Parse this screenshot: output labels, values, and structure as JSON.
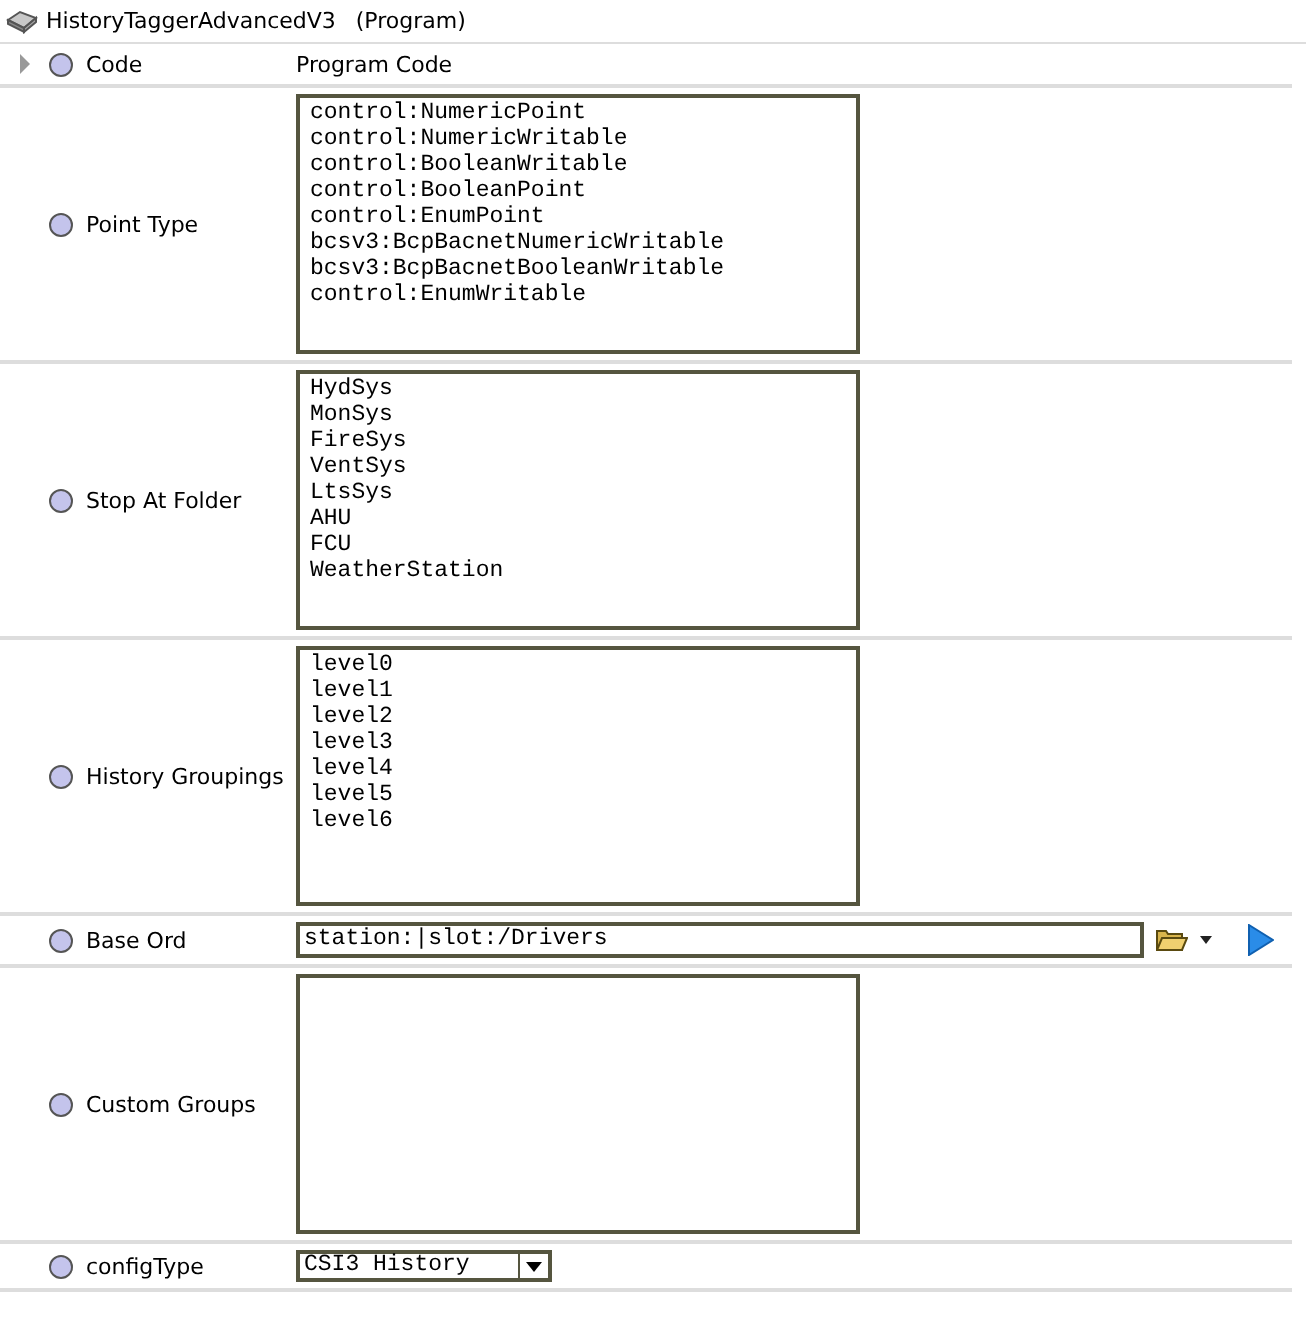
{
  "header": {
    "title": "HistoryTaggerAdvancedV3",
    "type": "(Program)"
  },
  "rows": [
    {
      "label": "Code",
      "kind": "text",
      "expanded": false,
      "value": "Program Code"
    },
    {
      "label": "Point Type",
      "kind": "textarea",
      "lines": [
        "control:NumericPoint",
        "control:NumericWritable",
        "control:BooleanWritable",
        "control:BooleanPoint",
        "control:EnumPoint",
        "bcsv3:BcpBacnetNumericWritable",
        "bcsv3:BcpBacnetBooleanWritable",
        "control:EnumWritable"
      ]
    },
    {
      "label": "Stop At Folder",
      "kind": "textarea",
      "lines": [
        "HydSys",
        "MonSys",
        "FireSys",
        "VentSys",
        "LtsSys",
        "AHU",
        "FCU",
        "WeatherStation"
      ]
    },
    {
      "label": "History Groupings",
      "kind": "textarea",
      "lines": [
        "level0",
        "level1",
        "level2",
        "level3",
        "level4",
        "level5",
        "level6"
      ]
    },
    {
      "label": "Base Ord",
      "kind": "ord",
      "value": "station:|slot:/Drivers"
    },
    {
      "label": "Custom Groups",
      "kind": "textarea",
      "lines": []
    },
    {
      "label": "configType",
      "kind": "select",
      "value": "CSI3 History"
    }
  ]
}
